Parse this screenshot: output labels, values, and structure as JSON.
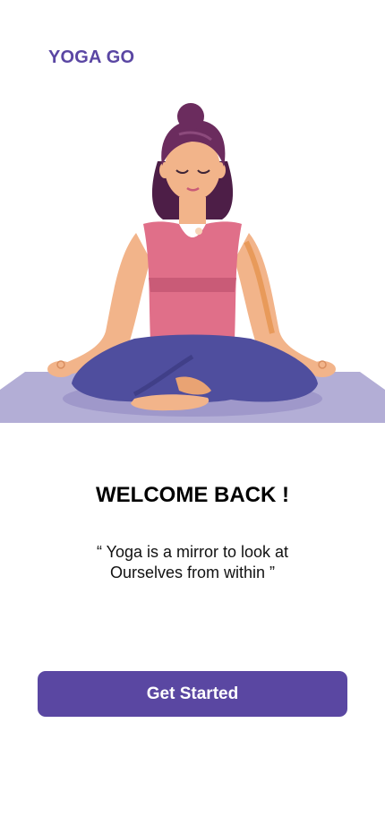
{
  "app": {
    "brand": "YOGA GO"
  },
  "hero": {
    "illustration": "woman-meditating-lotus-pose-illustration"
  },
  "welcome": {
    "title": "WELCOME BACK !",
    "quote_line1": "“ Yoga is a mirror to look at",
    "quote_line2": "Ourselves from within ”"
  },
  "actions": {
    "get_started_label": "Get Started"
  },
  "colors": {
    "brand": "#5A46A3",
    "button": "#5A47A2",
    "mat": "#B3AED6",
    "top": "#E06F89",
    "pants": "#4F4E9E",
    "hair": "#6B2C5E",
    "skin": "#F2B48A"
  }
}
